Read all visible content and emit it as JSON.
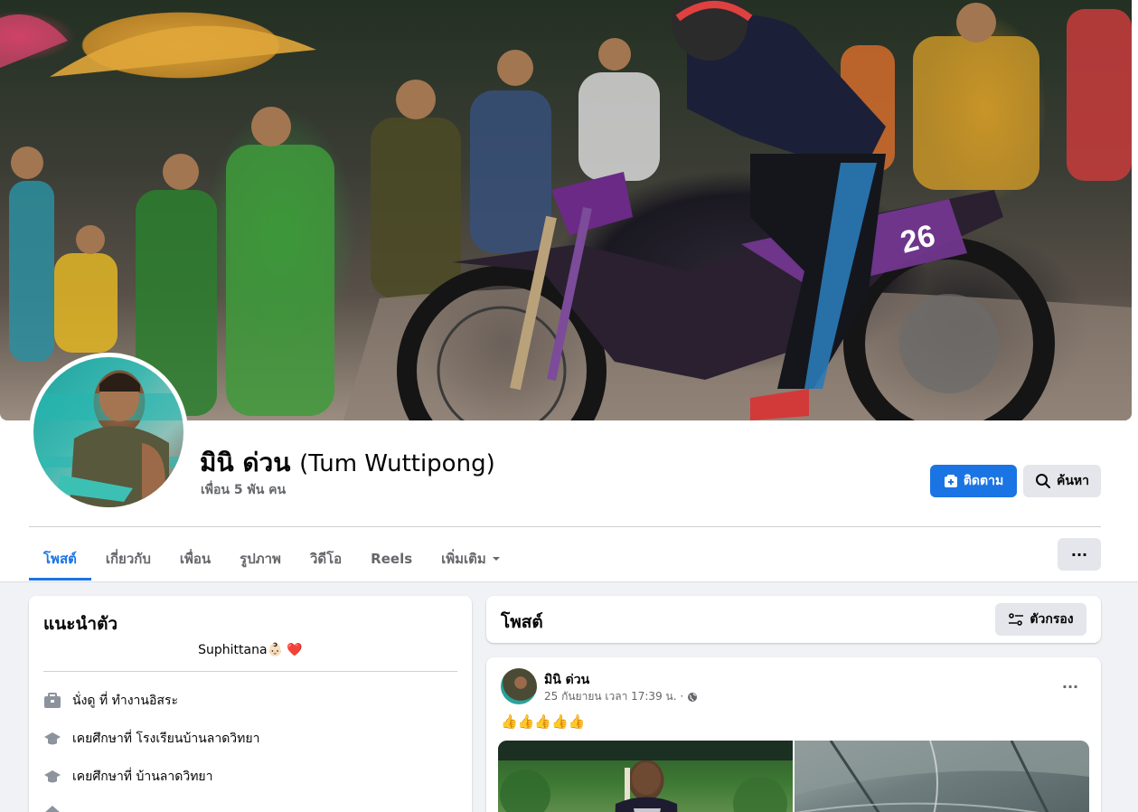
{
  "profile": {
    "name": "มินิ ด่วน",
    "alt_name": "(Tum Wuttipong)",
    "friends": "เพื่อน 5 พัน คน"
  },
  "actions": {
    "follow_label": "ติดตาม",
    "search_label": "ค้นหา",
    "more_label": "···"
  },
  "tabs": [
    {
      "label": "โพสต์"
    },
    {
      "label": "เกี่ยวกับ"
    },
    {
      "label": "เพื่อน"
    },
    {
      "label": "รูปภาพ"
    },
    {
      "label": "วิดีโอ"
    },
    {
      "label": "Reels"
    },
    {
      "label": "เพิ่มเติม"
    }
  ],
  "intro": {
    "title": "แนะนำตัว",
    "bio": "Suphittana👶🏻 ❤️",
    "items": [
      {
        "icon": "briefcase-icon",
        "text": "นั่งดู ที่ ทำงานอิสระ"
      },
      {
        "icon": "graduation-cap-icon",
        "text": "เคยศึกษาที่ โรงเรียนบ้านลาดวิทยา"
      },
      {
        "icon": "graduation-cap-icon",
        "text": "เคยศึกษาที่ บ้านลาดวิทยา"
      }
    ]
  },
  "posts": {
    "title": "โพสต์",
    "filter_label": "ตัวกรอง",
    "items": [
      {
        "author": "มินิ ด่วน",
        "time": "25 กันยายน เวลา 17:39 น. ·",
        "text": "👍👍👍👍👍",
        "more_label": "···"
      }
    ]
  },
  "colors": {
    "accent": "#1b74e4",
    "background": "#f0f2f5",
    "secondary_text": "#65676b"
  }
}
